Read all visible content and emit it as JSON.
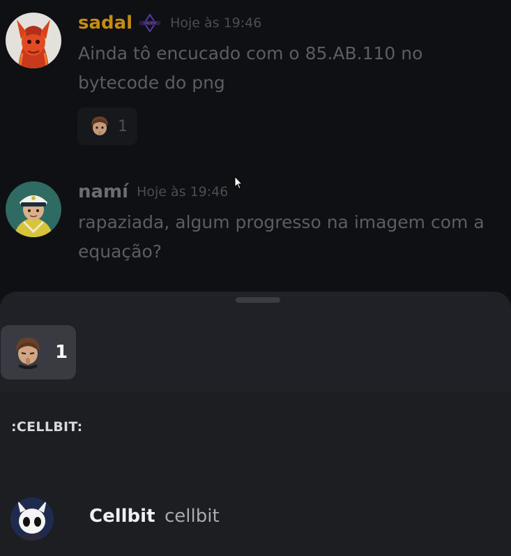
{
  "messages": [
    {
      "username": "sadal",
      "username_color": "#c28d12",
      "timestamp": "Hoje às 19:46",
      "text_line1": "Ainda tô encucado com o 85.AB.110 no",
      "text_line2": "bytecode do png",
      "reaction": {
        "emoji_icon": "cellbit-emoji-icon",
        "count": "1"
      }
    },
    {
      "username": "namí",
      "username_color": "#6b6d73",
      "timestamp": "Hoje às 19:46",
      "text_line1": "rapaziada, algum progresso na imagem com a",
      "text_line2": "equação?"
    }
  ],
  "reactions_sheet": {
    "selected_reaction": {
      "emoji_icon": "cellbit-emoji-icon",
      "count": "1"
    },
    "emoji_name": ":CELLBIT:",
    "users": [
      {
        "display_name": "Cellbit",
        "username": "cellbit",
        "avatar_icon": "hollow-knight-avatar"
      }
    ]
  },
  "colors": {
    "background": "#0f1013",
    "sheet": "#202126",
    "selected_tab": "#3a3b42",
    "accent_username": "#c28d12"
  }
}
